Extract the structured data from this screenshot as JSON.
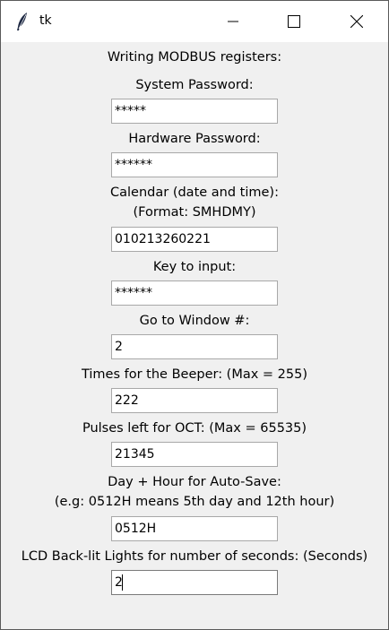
{
  "window": {
    "title": "tk"
  },
  "form": {
    "heading": "Writing MODBUS registers:",
    "fields": [
      {
        "label": "System Password:",
        "value": "*****"
      },
      {
        "label": "Hardware Password:",
        "value": "******"
      },
      {
        "label": "Calendar (date and time):",
        "label2": "(Format: SMHDMY)",
        "value": "010213260221"
      },
      {
        "label": "Key to input:",
        "value": "******"
      },
      {
        "label": "Go to Window #:",
        "value": "2"
      },
      {
        "label": "Times for the Beeper: (Max = 255)",
        "value": "222"
      },
      {
        "label": "Pulses left for OCT: (Max = 65535)",
        "value": "21345"
      },
      {
        "label": "Day + Hour for Auto-Save:",
        "label2": "(e.g: 0512H means 5th day and 12th hour)",
        "value": "0512H"
      },
      {
        "label": "LCD Back-lit Lights for number of seconds: (Seconds)",
        "value": "2"
      }
    ]
  },
  "icons": {
    "app": "feather-icon",
    "minimize": "minimize-icon",
    "maximize": "maximize-icon",
    "close": "close-icon"
  }
}
